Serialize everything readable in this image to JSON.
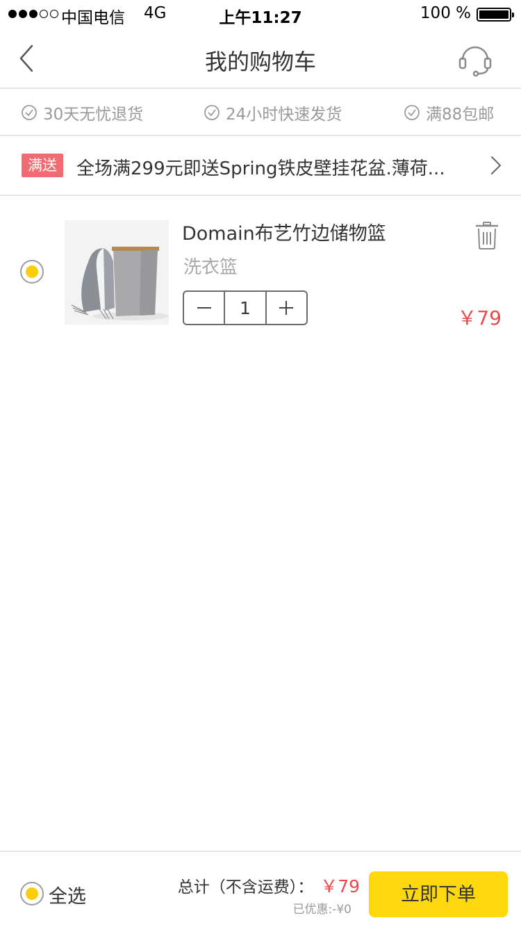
{
  "status_bar": {
    "signal_dots_filled": 3,
    "signal_dots_total": 5,
    "carrier": "中国电信",
    "network": "4G",
    "time": "上午11:27",
    "battery_text": "100 %",
    "battery_level": 1.0
  },
  "nav": {
    "back_icon": "chevron-left-icon",
    "title": "我的购物车",
    "service_icon": "headset-icon"
  },
  "guarantees": [
    {
      "icon": "check-circle-icon",
      "label": "30天无忧退货"
    },
    {
      "icon": "check-circle-icon",
      "label": "24小时快速发货"
    },
    {
      "icon": "check-circle-icon",
      "label": "满88包邮"
    }
  ],
  "promo": {
    "tag": "满送",
    "text": "全场满299元即送Spring铁皮壁挂花盆.薄荷...",
    "arrow_icon": "chevron-right-icon"
  },
  "cart_items": [
    {
      "selected": true,
      "image_icon": "storage-basket-photo",
      "name": "Domain布艺竹边储物篮",
      "spec": "洗衣篮",
      "quantity": "1",
      "price": "￥79",
      "delete_icon": "trash-icon"
    }
  ],
  "footer": {
    "select_all_label": "全选",
    "select_all_checked": true,
    "total_label": "总计（不含运费）：",
    "total_price": "￥79",
    "discount_text": "已优惠:-¥0",
    "order_button": "立即下单"
  },
  "colors": {
    "accent_yellow": "#fdd80d",
    "radio_fill": "#fcce0a",
    "price_red": "#e84b4b",
    "promo_tag_red": "#f06b72",
    "muted_gray": "#9a9a9a"
  }
}
